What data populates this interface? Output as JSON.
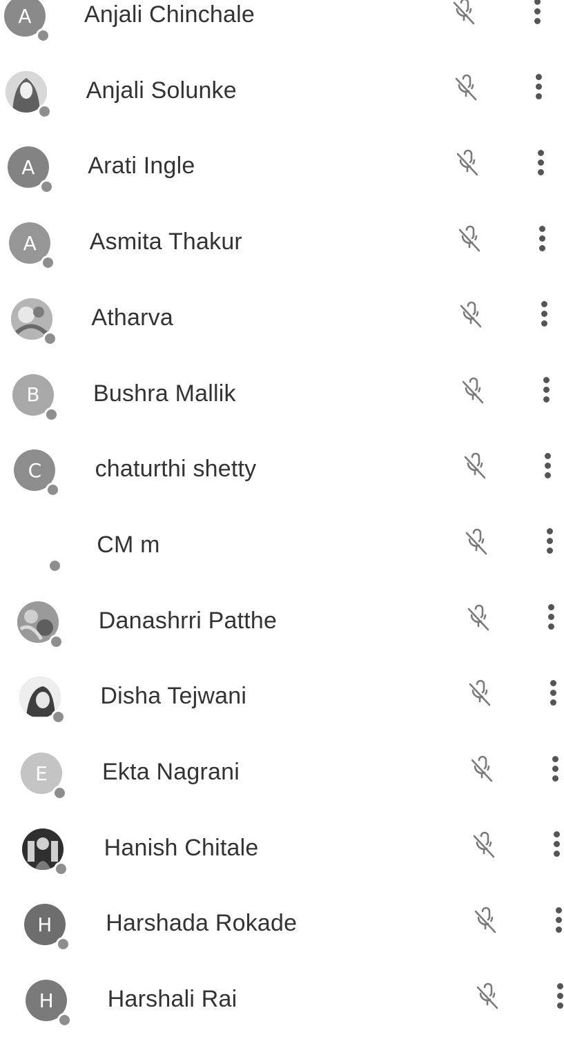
{
  "participants": [
    {
      "name": "Anjali Chinchale",
      "initial": "A",
      "avatar": "letter",
      "color": "#8a8a8a",
      "mic": "mic-off-icon",
      "menu": "more-vert-icon"
    },
    {
      "name": "Anjali Solunke",
      "initial": "",
      "avatar": "photo",
      "color": "#7a7a7a",
      "mic": "mic-off-icon",
      "menu": "more-vert-icon"
    },
    {
      "name": "Arati Ingle",
      "initial": "A",
      "avatar": "letter",
      "color": "#838383",
      "mic": "mic-off-icon",
      "menu": "more-vert-icon"
    },
    {
      "name": "Asmita Thakur",
      "initial": "A",
      "avatar": "letter",
      "color": "#969696",
      "mic": "mic-off-icon",
      "menu": "more-vert-icon"
    },
    {
      "name": "Atharva",
      "initial": "",
      "avatar": "photo",
      "color": "#9b9b9b",
      "mic": "mic-off-icon",
      "menu": "more-vert-icon"
    },
    {
      "name": "Bushra Mallik",
      "initial": "B",
      "avatar": "letter",
      "color": "#a8a8a8",
      "mic": "mic-off-icon",
      "menu": "more-vert-icon"
    },
    {
      "name": "chaturthi shetty",
      "initial": "C",
      "avatar": "letter",
      "color": "#8d8d8d",
      "mic": "mic-off-icon",
      "menu": "more-vert-icon"
    },
    {
      "name": "CM m",
      "initial": "",
      "avatar": "none",
      "color": "#ffffff",
      "mic": "mic-off-icon",
      "menu": "more-vert-icon"
    },
    {
      "name": "Danashrri Patthe",
      "initial": "",
      "avatar": "photo",
      "color": "#8a8a8a",
      "mic": "mic-off-icon",
      "menu": "more-vert-icon"
    },
    {
      "name": "Disha Tejwani",
      "initial": "",
      "avatar": "photo",
      "color": "#7f7f7f",
      "mic": "mic-off-icon",
      "menu": "more-vert-icon"
    },
    {
      "name": "Ekta Nagrani",
      "initial": "E",
      "avatar": "letter",
      "color": "#c4c4c4",
      "mic": "mic-off-icon",
      "menu": "more-vert-icon"
    },
    {
      "name": "Hanish Chitale",
      "initial": "",
      "avatar": "photo",
      "color": "#5a5a5a",
      "mic": "mic-off-icon",
      "menu": "more-vert-icon"
    },
    {
      "name": "Harshada Rokade",
      "initial": "H",
      "avatar": "letter",
      "color": "#6e6e6e",
      "mic": "mic-off-icon",
      "menu": "more-vert-icon"
    },
    {
      "name": "Harshali Rai",
      "initial": "H",
      "avatar": "letter",
      "color": "#7a7a7a",
      "mic": "mic-off-icon",
      "menu": "more-vert-icon"
    }
  ]
}
